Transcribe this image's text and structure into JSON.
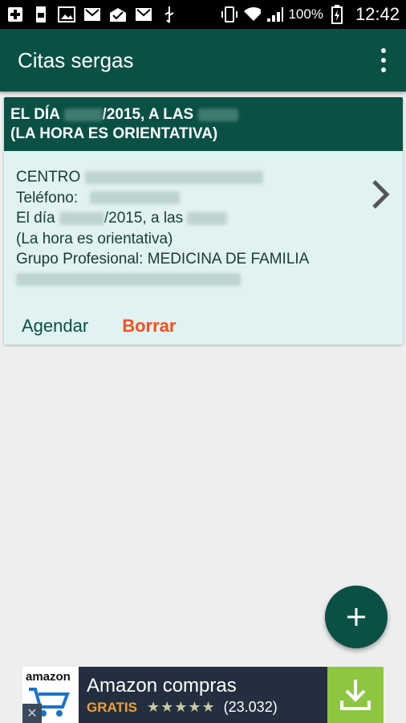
{
  "status_bar": {
    "battery_percent": "100%",
    "time": "12:42"
  },
  "app_bar": {
    "title": "Citas sergas"
  },
  "card": {
    "header_line1_prefix": "EL DÍA",
    "header_line1_middle": "/2015, A LAS",
    "header_line2": "(LA HORA ES ORIENTATIVA)",
    "centro_label": "CENTRO",
    "telefono_label": "Teléfono:",
    "dia_prefix": "El día",
    "dia_middle": "/2015, a las",
    "hora_note": "(La hora es orientativa)",
    "grupo": "Grupo Profesional: MEDICINA DE FAMILIA",
    "agendar_label": "Agendar",
    "borrar_label": "Borrar"
  },
  "ad": {
    "logo_text": "amazon",
    "title": "Amazon compras",
    "price_label": "GRATIS",
    "rating": 4.5,
    "stars": "★★★★★",
    "rating_count": "(23.032)",
    "close_label": "✕"
  },
  "colors": {
    "primary": "#0a5045",
    "card_bg": "#e0f2f1",
    "accent": "#f4511e",
    "download_bg": "#8dc63f"
  }
}
